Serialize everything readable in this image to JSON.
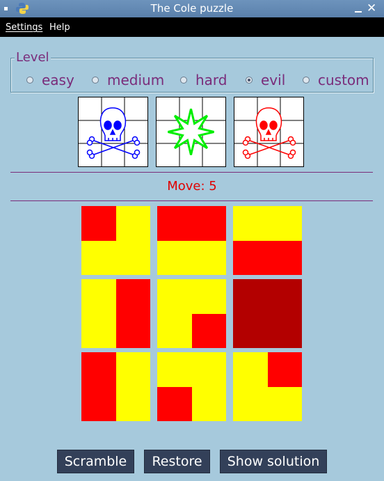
{
  "window": {
    "title": "The Cole puzzle"
  },
  "menu": [
    {
      "label": "Settings"
    },
    {
      "label": "Help"
    }
  ],
  "level": {
    "legend": "Level",
    "options": [
      {
        "label": "easy",
        "checked": false
      },
      {
        "label": "medium",
        "checked": false
      },
      {
        "label": "hard",
        "checked": false
      },
      {
        "label": "evil",
        "checked": true
      },
      {
        "label": "custom",
        "checked": false
      }
    ]
  },
  "targets": [
    {
      "icon": "skull-crossbones-icon",
      "color": "#0000ff"
    },
    {
      "icon": "star-burst-icon",
      "color": "#00ee00"
    },
    {
      "icon": "skull-crossbones-icon",
      "color": "#ff0000"
    }
  ],
  "move": {
    "text": "Move: 5"
  },
  "colors": {
    "red": "#ff0000",
    "yellow": "#ffff00",
    "dark_red": "#b30000"
  },
  "board": [
    {
      "quadrants": [
        "red",
        "yellow",
        "yellow",
        "yellow"
      ]
    },
    {
      "quadrants": [
        "red",
        "red",
        "yellow",
        "yellow"
      ]
    },
    {
      "quadrants": [
        "yellow",
        "yellow",
        "red",
        "red"
      ]
    },
    {
      "quadrants": [
        "yellow",
        "red",
        "yellow",
        "red"
      ]
    },
    {
      "quadrants": [
        "yellow",
        "yellow",
        "yellow",
        "red"
      ]
    },
    {
      "quadrants": [
        "dark_red",
        "dark_red",
        "dark_red",
        "dark_red"
      ]
    },
    {
      "quadrants": [
        "red",
        "yellow",
        "red",
        "yellow"
      ]
    },
    {
      "quadrants": [
        "yellow",
        "yellow",
        "red",
        "yellow"
      ]
    },
    {
      "quadrants": [
        "yellow",
        "red",
        "yellow",
        "yellow"
      ]
    }
  ],
  "buttons": {
    "scramble": "Scramble",
    "restore": "Restore",
    "show_solution": "Show solution"
  }
}
